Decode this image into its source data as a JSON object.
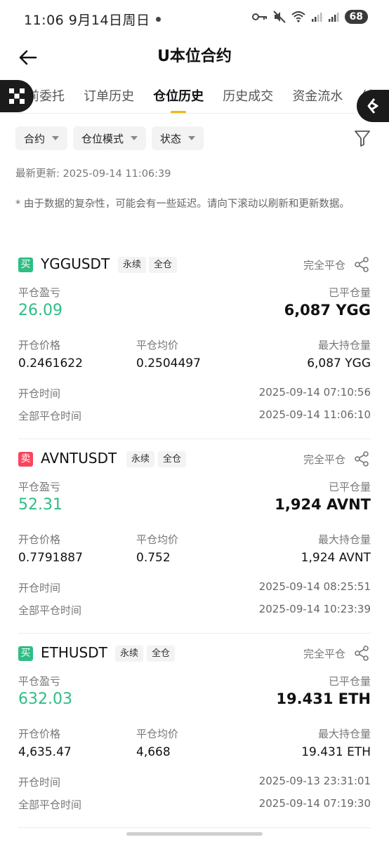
{
  "status_bar": {
    "time_date": "11:06  9月14日周日",
    "battery": "68"
  },
  "header": {
    "title": "U本位合约"
  },
  "tabs": [
    {
      "label": "前委托"
    },
    {
      "label": "订单历史"
    },
    {
      "label": "仓位历史"
    },
    {
      "label": "历史成交"
    },
    {
      "label": "资金流水"
    },
    {
      "label": "结"
    }
  ],
  "filters": {
    "contract": "合约",
    "position_mode": "仓位模式",
    "status": "状态"
  },
  "last_update": "最新更新: 2025-09-14 11:06:39",
  "notice": "* 由于数据的复杂性，可能会有一些延迟。请向下滚动以刷新和更新数据。",
  "labels": {
    "pnl": "平仓盈亏",
    "closed_qty": "已平仓量",
    "open_price": "开仓价格",
    "close_avg_price": "平仓均价",
    "max_position": "最大持仓量",
    "open_time": "开仓时间",
    "full_close_time": "全部平仓时间"
  },
  "positions": [
    {
      "side": "买",
      "symbol": "YGGUSDT",
      "tag_type": "永续",
      "tag_margin": "全仓",
      "close_type": "完全平仓",
      "pnl": "26.09",
      "closed_qty": "6,087 YGG",
      "open_price": "0.2461622",
      "close_avg_price": "0.2504497",
      "max_position": "6,087 YGG",
      "open_time": "2025-09-14 07:10:56",
      "full_close_time": "2025-09-14 11:06:10"
    },
    {
      "side": "卖",
      "symbol": "AVNTUSDT",
      "tag_type": "永续",
      "tag_margin": "全仓",
      "close_type": "完全平仓",
      "pnl": "52.31",
      "closed_qty": "1,924 AVNT",
      "open_price": "0.7791887",
      "close_avg_price": "0.752",
      "max_position": "1,924 AVNT",
      "open_time": "2025-09-14 08:25:51",
      "full_close_time": "2025-09-14 10:23:39"
    },
    {
      "side": "买",
      "symbol": "ETHUSDT",
      "tag_type": "永续",
      "tag_margin": "全仓",
      "close_type": "完全平仓",
      "pnl": "632.03",
      "closed_qty": "19.431 ETH",
      "open_price": "4,635.47",
      "close_avg_price": "4,668",
      "max_position": "19.431 ETH",
      "open_time": "2025-09-13 23:31:01",
      "full_close_time": "2025-09-14 07:19:30"
    }
  ],
  "colors": {
    "accent": "#f0b90b",
    "buy": "#2ebd85",
    "sell": "#f6465d"
  }
}
